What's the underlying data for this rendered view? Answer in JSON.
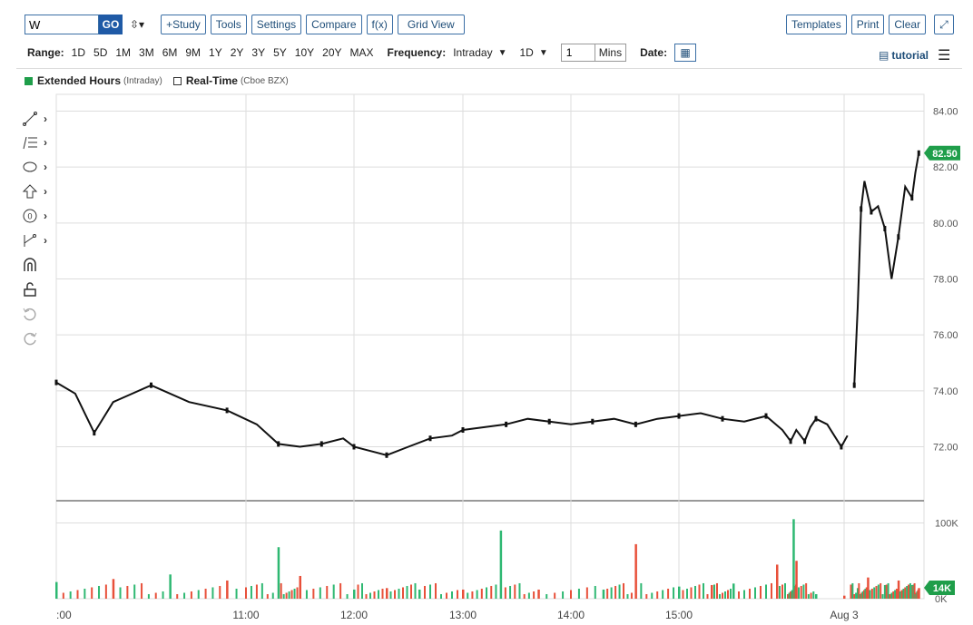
{
  "toolbar": {
    "symbol": "W",
    "go": "GO",
    "study": "+Study",
    "tools": "Tools",
    "settings": "Settings",
    "compare": "Compare",
    "fx": "f(x)",
    "grid": "Grid View",
    "templates": "Templates",
    "print": "Print",
    "clear": "Clear",
    "expand": "⤢"
  },
  "range": {
    "label": "Range:",
    "options": [
      "1D",
      "5D",
      "1M",
      "3M",
      "6M",
      "9M",
      "1Y",
      "2Y",
      "3Y",
      "5Y",
      "10Y",
      "20Y",
      "MAX"
    ],
    "freq_label": "Frequency:",
    "freq_value": "Intraday",
    "period": "1D",
    "interval": "1",
    "unit": "Mins",
    "date_label": "Date:",
    "tutorial": "tutorial"
  },
  "legend": {
    "extended": "Extended Hours",
    "extended_sub": "(Intraday)",
    "realtime": "Real-Time",
    "realtime_sub": "(Cboe BZX)"
  },
  "colors": {
    "up": "#2eb872",
    "down": "#e8503a",
    "last": "#1f9e4a",
    "line": "#111111"
  },
  "chart_data": {
    "type": "line",
    "price_ticks": [
      "84.00",
      "82.00",
      "80.00",
      "78.00",
      "76.00",
      "74.00",
      "72.00"
    ],
    "price_range": [
      70.2,
      84.6
    ],
    "last_price": "82.50",
    "volume_ticks": [
      "100K",
      "0K"
    ],
    "volume_range": [
      0,
      115000
    ],
    "last_volume": "14K",
    "x_labels": [
      ":00",
      "11:00",
      "12:00",
      "13:00",
      "14:00",
      "15:00",
      "Aug 3"
    ],
    "x_hours": [
      10.0,
      11.0,
      12.0,
      13.0,
      14.0,
      15.0,
      16.0
    ],
    "series": [
      {
        "points": [
          [
            10.0,
            74.3
          ],
          [
            10.1,
            73.9
          ],
          [
            10.2,
            72.5
          ],
          [
            10.3,
            73.6
          ],
          [
            10.5,
            74.2
          ],
          [
            10.7,
            73.6
          ],
          [
            10.9,
            73.3
          ],
          [
            11.1,
            72.8
          ],
          [
            11.3,
            72.1
          ],
          [
            11.5,
            72.0
          ],
          [
            11.7,
            72.1
          ],
          [
            11.9,
            72.3
          ],
          [
            12.0,
            72.0
          ],
          [
            12.2,
            71.8
          ],
          [
            12.3,
            71.7
          ],
          [
            12.5,
            72.0
          ],
          [
            12.7,
            72.3
          ],
          [
            12.9,
            72.4
          ],
          [
            13.0,
            72.6
          ],
          [
            13.2,
            72.7
          ],
          [
            13.4,
            72.8
          ],
          [
            13.6,
            73.0
          ],
          [
            13.8,
            72.9
          ],
          [
            14.0,
            72.8
          ],
          [
            14.2,
            72.9
          ],
          [
            14.4,
            73.0
          ],
          [
            14.6,
            72.8
          ],
          [
            14.8,
            73.0
          ],
          [
            15.0,
            73.1
          ],
          [
            15.2,
            73.2
          ],
          [
            15.4,
            73.0
          ],
          [
            15.6,
            72.9
          ],
          [
            15.8,
            73.1
          ],
          [
            15.95,
            72.6
          ],
          [
            16.05,
            72.2
          ],
          [
            16.15,
            72.6
          ],
          [
            16.3,
            72.2
          ],
          [
            16.4,
            72.7
          ],
          [
            16.5,
            73.0
          ],
          [
            16.7,
            72.8
          ],
          [
            16.95,
            72.0
          ],
          [
            17.05,
            72.4
          ]
        ]
      },
      {
        "points": [
          [
            17.15,
            74.2
          ],
          [
            17.2,
            77.0
          ],
          [
            17.25,
            80.5
          ],
          [
            17.3,
            81.5
          ],
          [
            17.4,
            80.4
          ],
          [
            17.5,
            80.6
          ],
          [
            17.6,
            79.8
          ],
          [
            17.7,
            78.0
          ],
          [
            17.8,
            79.5
          ],
          [
            17.9,
            81.3
          ],
          [
            18.0,
            80.9
          ],
          [
            18.05,
            81.8
          ],
          [
            18.1,
            82.5
          ]
        ]
      }
    ],
    "volumes": [
      [
        10.0,
        22000
      ],
      [
        10.3,
        26000
      ],
      [
        10.6,
        32000
      ],
      [
        10.9,
        24000
      ],
      [
        11.3,
        68000
      ],
      [
        11.5,
        30000
      ],
      [
        12.0,
        12000
      ],
      [
        12.3,
        14000
      ],
      [
        12.6,
        12000
      ],
      [
        13.0,
        12000
      ],
      [
        13.35,
        90000
      ],
      [
        13.7,
        12000
      ],
      [
        14.3,
        12000
      ],
      [
        14.6,
        72000
      ],
      [
        15.0,
        16000
      ],
      [
        15.3,
        18000
      ],
      [
        15.5,
        20000
      ],
      [
        15.9,
        45000
      ],
      [
        16.1,
        105000
      ],
      [
        16.15,
        50000
      ],
      [
        16.5,
        6000
      ],
      [
        17.0,
        4000
      ],
      [
        17.2,
        14000
      ],
      [
        17.35,
        28000
      ],
      [
        17.6,
        18000
      ],
      [
        17.8,
        24000
      ],
      [
        18.0,
        18000
      ],
      [
        18.1,
        14000
      ]
    ]
  }
}
